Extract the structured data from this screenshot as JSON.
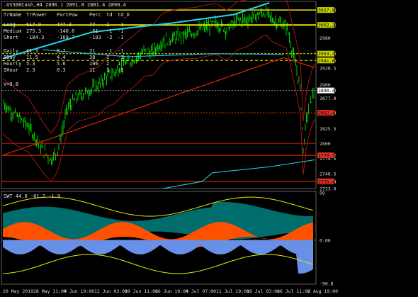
{
  "symbol_header": ".US500Cash,H4  2890.1 2891.8 2881.4 2890.4",
  "table": {
    "columns": [
      "TrName",
      "TrPower",
      "PartPow",
      "Perc",
      "td",
      "td_D"
    ],
    "rows": [
      [
        "Long",
        "617.9",
        "477.3",
        "77",
        "2",
        "-1"
      ],
      [
        "Medium",
        "275.3",
        "-140.6",
        "-51",
        "-1",
        "-1"
      ],
      [
        "Short",
        "-184.3",
        "-169.7",
        "-103",
        "-2",
        "-1"
      ],
      [
        "Daily",
        "41.3",
        "8.7",
        "21",
        "-1",
        "-1"
      ],
      [
        "IDay",
        "11.5",
        "4.4",
        "38",
        "1",
        "-1"
      ],
      [
        "Hourly",
        "5.3",
        "5.6",
        "106",
        "2",
        "1"
      ],
      [
        "IHour",
        "2.3",
        "0.3",
        "11",
        "1",
        "-1"
      ]
    ],
    "footer": "V=9.8"
  },
  "price_axis": [
    "3027.8",
    "3002.2",
    "2980",
    "2953.3",
    "2941.6",
    "2928.5",
    "2900",
    "2890.4",
    "2877.0",
    "2852.4",
    "2825.5",
    "2800",
    "2779.7",
    "2774.5",
    "2748.5",
    "2735.4",
    "2723.0"
  ],
  "price_tags": [
    {
      "label": "3027.8",
      "color": "#c8d400"
    },
    {
      "label": "3002.2",
      "color": "#c8d400"
    },
    {
      "label": "2953.3",
      "color": "#c8d400"
    },
    {
      "label": "2941.6",
      "color": "#c8d400"
    },
    {
      "label": "2890.4",
      "color": "#ffffff"
    },
    {
      "label": "2852.4",
      "color": "#e03020"
    },
    {
      "label": "2779.7",
      "color": "#e03020"
    },
    {
      "label": "2735.4",
      "color": "#e03020"
    }
  ],
  "osc_header": "SWT 44.0 -61.7 -1.9",
  "osc_axis": [
    "99",
    "0.00",
    "-90.8"
  ],
  "time_axis": [
    "20 May 2019",
    "28 May 11:00",
    "4 Jun 19:00",
    "12 Jun 03:00",
    "19 Jun 11:00",
    "26 Jun 19:00",
    "4 Jul 07:00",
    "11 Jul 19:00",
    "19 Jul 03:00",
    "26 Jul 11:00",
    "2 Aug 19:00"
  ],
  "colors": {
    "candle_up": "#00c800",
    "candle_down": "#00c800",
    "ma": "#ff3000",
    "channel": "#a01810",
    "cyan": "#20d8e8",
    "yellow": "#e8e800",
    "orange": "#ff5000",
    "teal": "#008080",
    "blue": "#6890e8"
  },
  "chart_data": {
    "type": "line",
    "x": [
      "20 May 2019",
      "28 May 11:00",
      "4 Jun 19:00",
      "12 Jun 03:00",
      "19 Jun 11:00",
      "26 Jun 19:00",
      "4 Jul 07:00",
      "11 Jul 19:00",
      "19 Jul 03:00",
      "26 Jul 11:00",
      "2 Aug 19:00"
    ],
    "series": [
      {
        "values": [
          2852,
          2780,
          2858,
          2895,
          2952,
          2955,
          2978,
          2988,
          3000,
          3018,
          2900
        ]
      }
    ],
    "ylim": [
      2723,
      3040
    ]
  }
}
